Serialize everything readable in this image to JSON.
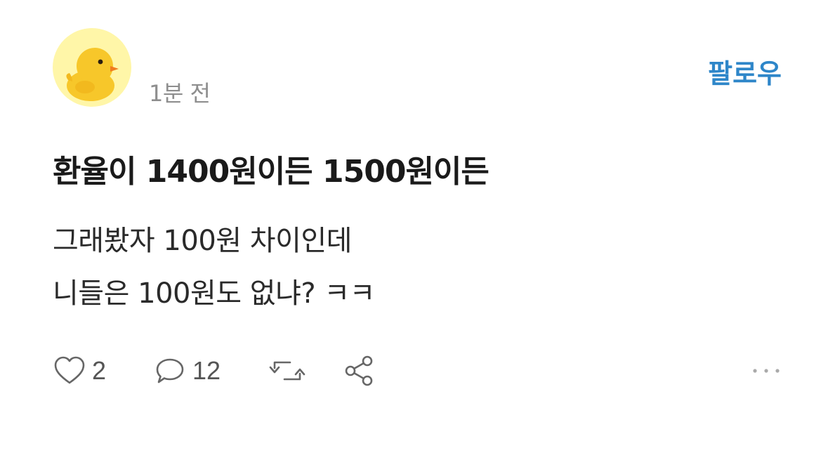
{
  "post": {
    "time": "1분 전",
    "follow_label": "팔로우",
    "title": "환율이 1400원이든 1500원이든",
    "body_line1": "그래봤자 100원 차이인데",
    "body_line2": "니들은 100원도 없냐? ㅋㅋ"
  },
  "actions": {
    "like_count": "2",
    "comment_count": "12"
  },
  "colors": {
    "follow": "#2e86c9",
    "avatar_bg": "#fff6a8",
    "duck": "#f7c72a",
    "beak": "#f07c20"
  },
  "icons": {
    "avatar": "yellow-duck",
    "like": "heart-outline-icon",
    "comment": "speech-bubble-icon",
    "repost": "repost-arrows-icon",
    "share": "share-nodes-icon",
    "more": "ellipsis-icon"
  }
}
